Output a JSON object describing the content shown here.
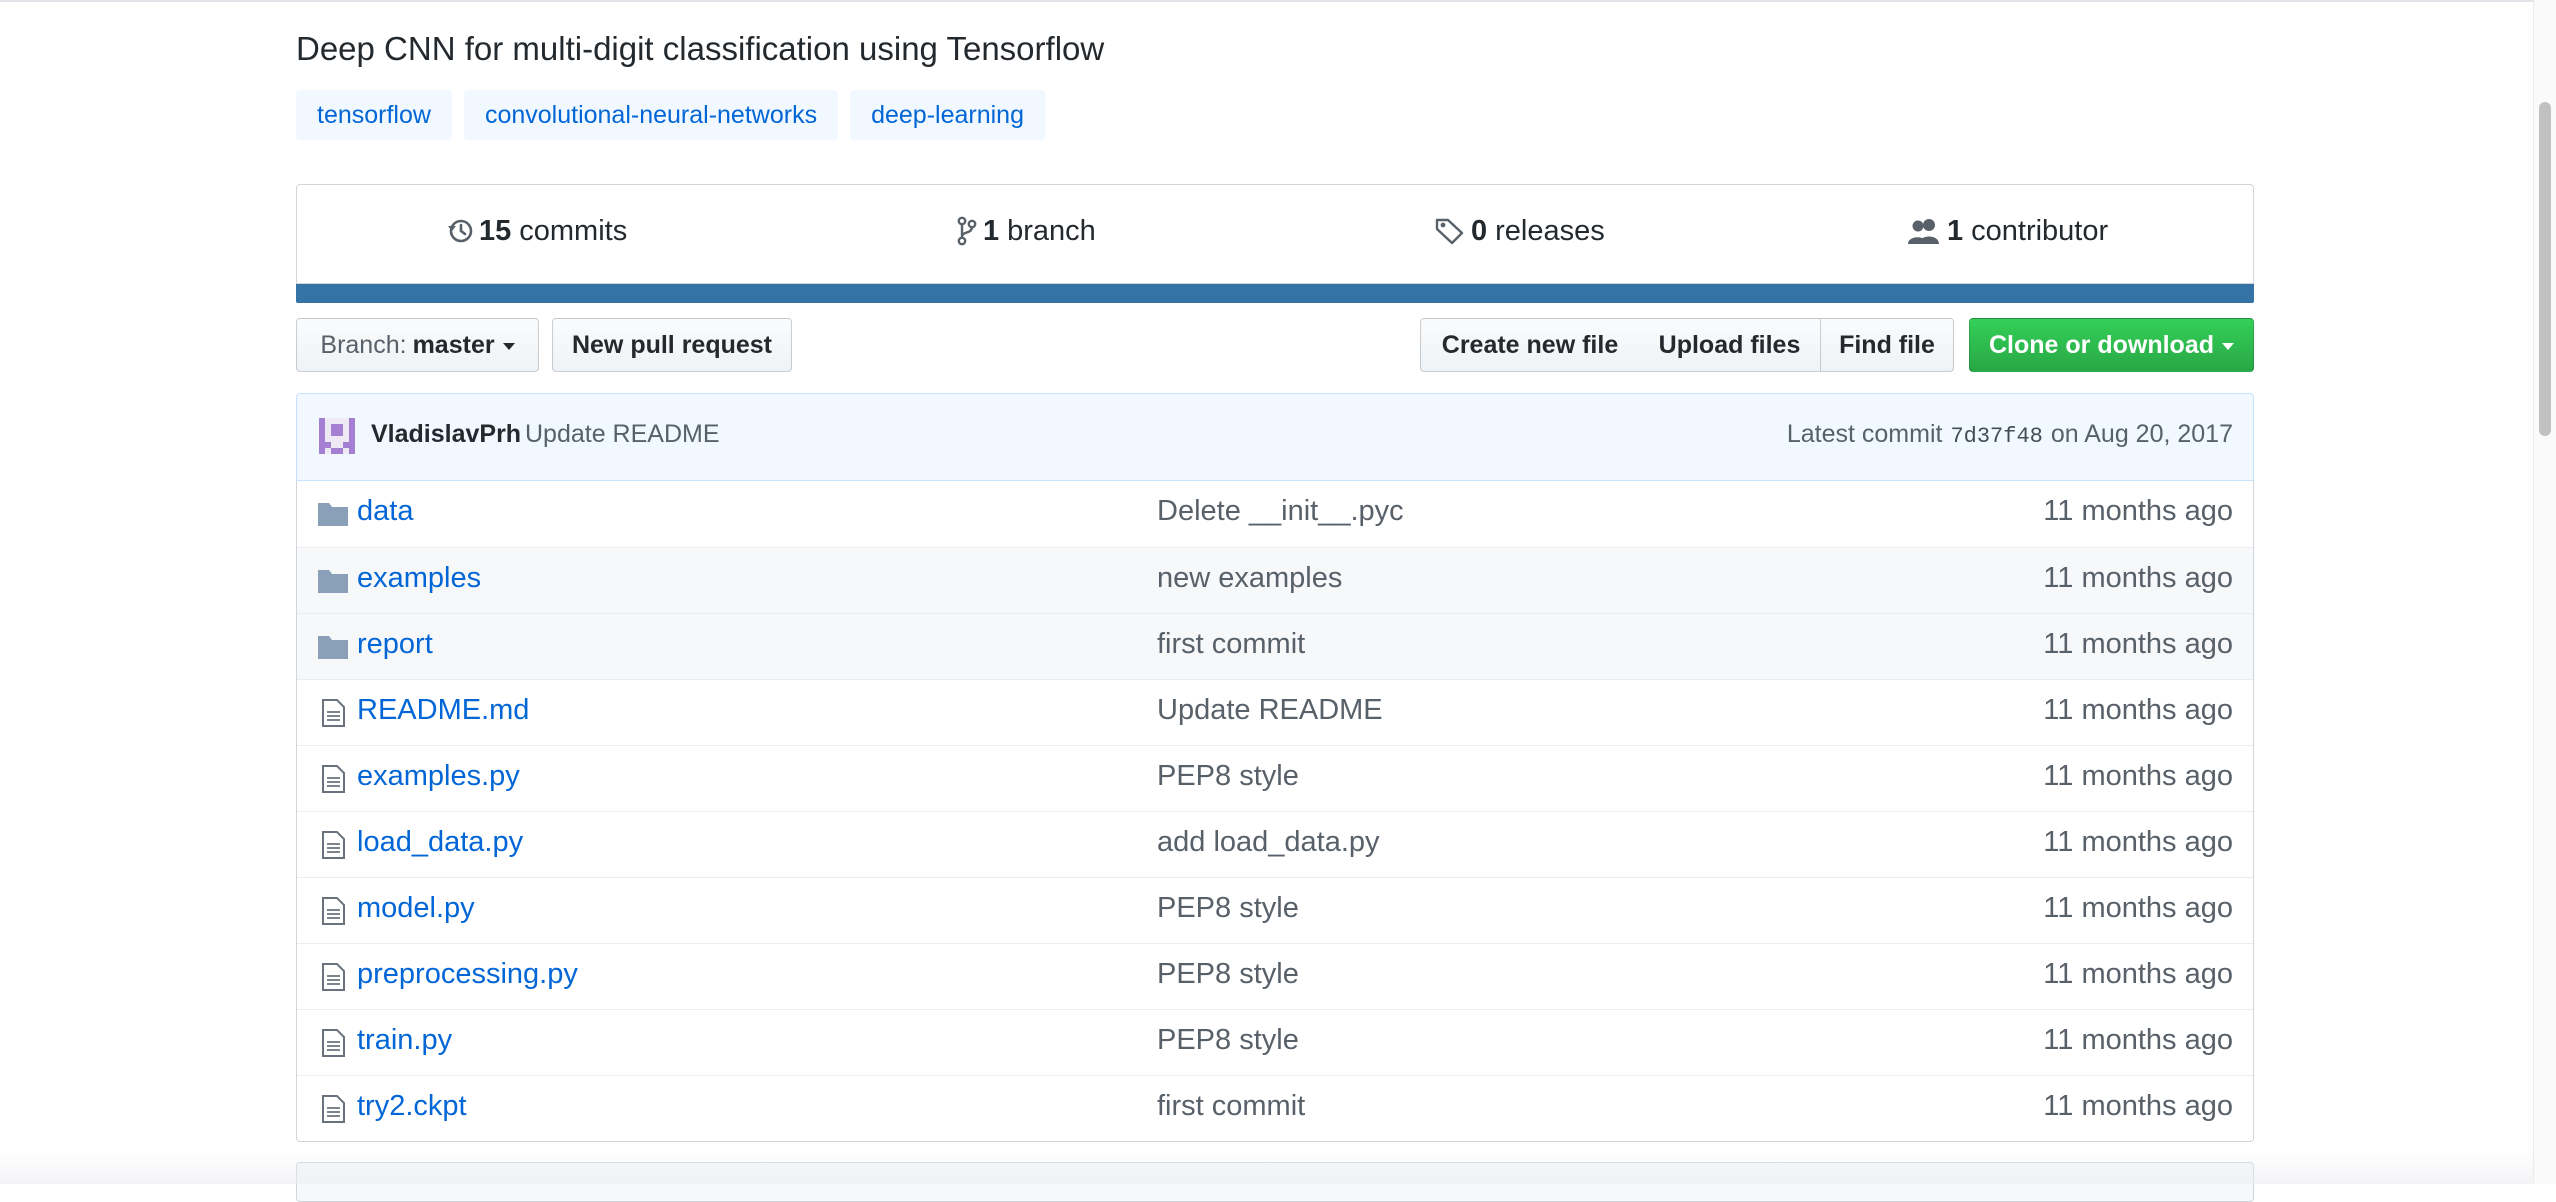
{
  "repo": {
    "description": "Deep CNN for multi-digit classification using Tensorflow",
    "topics": [
      "tensorflow",
      "convolutional-neural-networks",
      "deep-learning"
    ]
  },
  "summary": {
    "commits": {
      "count": "15",
      "label": "commits",
      "icon": "history-icon"
    },
    "branches": {
      "count": "1",
      "label": "branch",
      "icon": "git-branch-icon"
    },
    "releases": {
      "count": "0",
      "label": "releases",
      "icon": "tag-icon"
    },
    "contributors": {
      "count": "1",
      "label": "contributor",
      "icon": "people-icon"
    },
    "language_color": "#3572A5"
  },
  "toolbar": {
    "branch_prefix": "Branch:",
    "branch_name": "master",
    "new_pull_request": "New pull request",
    "create_new_file": "Create new file",
    "upload_files": "Upload files",
    "find_file": "Find file",
    "clone_or_download": "Clone or download"
  },
  "latest_commit": {
    "author": "VladislavPrh",
    "message": "Update README",
    "prefix": "Latest commit",
    "sha": "7d37f48",
    "date": "on Aug 20, 2017"
  },
  "files": [
    {
      "name": "data",
      "type": "folder",
      "message": "Delete __init__.pyc",
      "age": "11 months ago"
    },
    {
      "name": "examples",
      "type": "folder",
      "message": "new examples",
      "age": "11 months ago"
    },
    {
      "name": "report",
      "type": "folder",
      "message": "first commit",
      "age": "11 months ago"
    },
    {
      "name": "README.md",
      "type": "file",
      "message": "Update README",
      "age": "11 months ago"
    },
    {
      "name": "examples.py",
      "type": "file",
      "message": "PEP8 style",
      "age": "11 months ago"
    },
    {
      "name": "load_data.py",
      "type": "file",
      "message": "add load_data.py",
      "age": "11 months ago"
    },
    {
      "name": "model.py",
      "type": "file",
      "message": "PEP8 style",
      "age": "11 months ago"
    },
    {
      "name": "preprocessing.py",
      "type": "file",
      "message": "PEP8 style",
      "age": "11 months ago"
    },
    {
      "name": "train.py",
      "type": "file",
      "message": "PEP8 style",
      "age": "11 months ago"
    },
    {
      "name": "try2.ckpt",
      "type": "file",
      "message": "first commit",
      "age": "11 months ago"
    }
  ],
  "colors": {
    "link": "#0366d6",
    "muted": "#586069",
    "green_button": "#28a745",
    "commit_bar_bg": "#f1f8ff",
    "folder_icon": "#79b8ff"
  }
}
